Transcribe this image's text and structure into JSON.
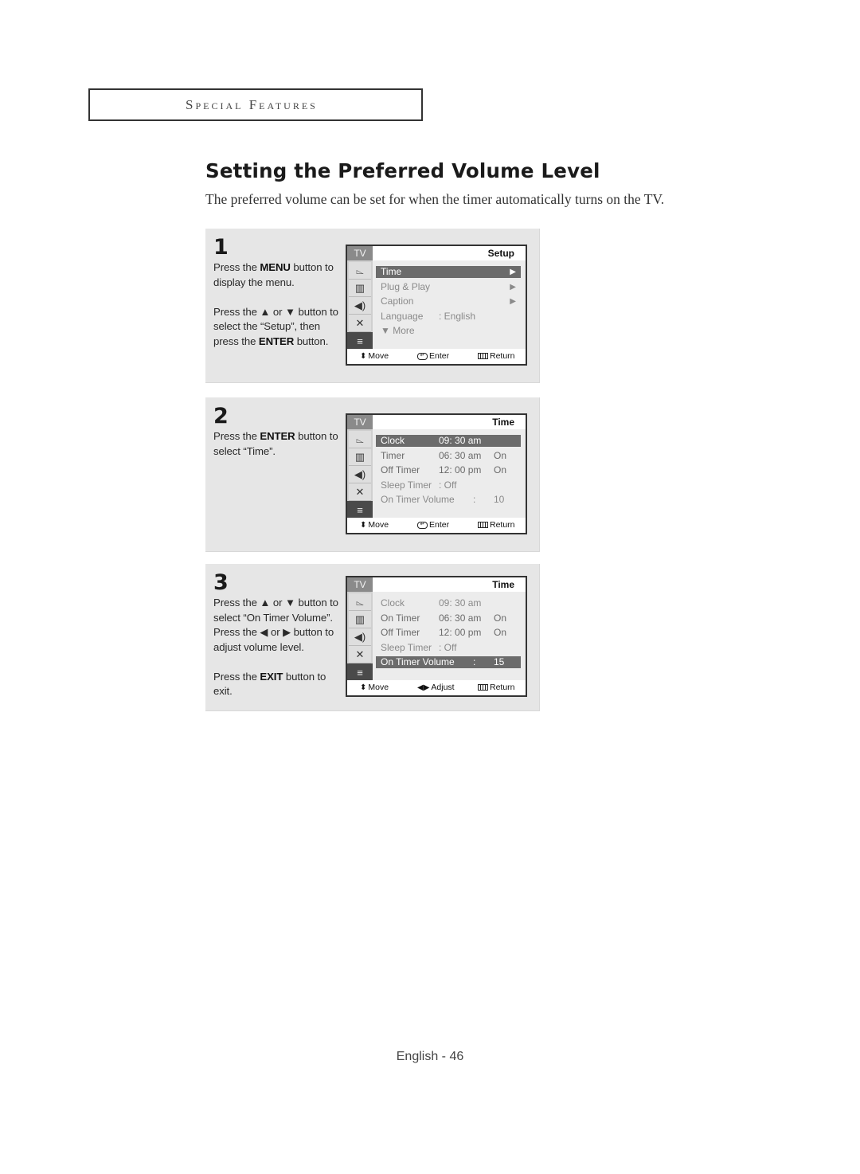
{
  "section_header": "Special Features",
  "title": "Setting the Preferred Volume Level",
  "intro": "The preferred volume can be set for when the timer automatically turns on the TV.",
  "steps": [
    {
      "number": "1",
      "paragraphs": [
        [
          {
            "t": "Press the "
          },
          {
            "t": "MENU",
            "b": true
          },
          {
            "t": " button to display the menu."
          }
        ],
        [
          {
            "t": "Press the ▲ or ▼ button to select the “Setup”, then press the "
          },
          {
            "t": "ENTER",
            "b": true
          },
          {
            "t": " button."
          }
        ]
      ],
      "osd": {
        "tv_label": "TV",
        "menu_title": "Setup",
        "rows": [
          {
            "c1": "Time",
            "arrow": "▶",
            "highlighted": true
          },
          {
            "c1": "Plug & Play",
            "arrow": "▶"
          },
          {
            "c1": "Caption",
            "arrow": "▶"
          },
          {
            "c1": "Language",
            "c2": ":  English"
          },
          {
            "c1": "  ▼ More"
          }
        ],
        "footer": [
          {
            "icon": "up-down-arrow-icon",
            "glyph": "⬍",
            "label": "Move"
          },
          {
            "icon": "enter-icon",
            "glyph": "↵",
            "label": "Enter"
          },
          {
            "icon": "return-icon",
            "glyph": "",
            "label": "Return"
          }
        ]
      }
    },
    {
      "number": "2",
      "paragraphs": [
        [
          {
            "t": "Press the "
          },
          {
            "t": "ENTER",
            "b": true
          },
          {
            "t": " button to select “Time”."
          }
        ]
      ],
      "osd": {
        "tv_label": "TV",
        "menu_title": "Time",
        "rows": [
          {
            "c1": "Clock",
            "c2": "09: 30 am",
            "highlighted": true
          },
          {
            "c1": "Timer",
            "c2": "06: 30 am",
            "c3": "On"
          },
          {
            "c1": "Off Timer",
            "c2": "12: 00 pm",
            "c3": "On"
          },
          {
            "c1": "Sleep Timer",
            "c2": "    : Off"
          },
          {
            "c1": "On Timer Volume",
            "c2": "",
            "c3": "10",
            "sep": ":"
          }
        ],
        "footer": [
          {
            "icon": "up-down-arrow-icon",
            "glyph": "⬍",
            "label": "Move"
          },
          {
            "icon": "enter-icon",
            "glyph": "↵",
            "label": "Enter"
          },
          {
            "icon": "return-icon",
            "glyph": "",
            "label": "Return"
          }
        ]
      }
    },
    {
      "number": "3",
      "paragraphs": [
        [
          {
            "t": "Press the ▲ or ▼ button to select “On Timer Volume”. Press the ◀ or ▶ button to adjust volume level."
          }
        ],
        [
          {
            "t": "Press the "
          },
          {
            "t": "EXIT",
            "b": true
          },
          {
            "t": " button to exit."
          }
        ]
      ],
      "osd": {
        "tv_label": "TV",
        "menu_title": "Time",
        "rows": [
          {
            "c1": "Clock",
            "c2": "09: 30 am"
          },
          {
            "c1": "On Timer",
            "c2": "06: 30 am",
            "c3": "On"
          },
          {
            "c1": "Off Timer",
            "c2": "12: 00 pm",
            "c3": "On"
          },
          {
            "c1": "Sleep Timer",
            "c2": "    : Off"
          },
          {
            "c1": "On Timer Volume",
            "c2": "",
            "c3": "15",
            "sep": ":",
            "highlighted": true
          }
        ],
        "footer": [
          {
            "icon": "up-down-arrow-icon",
            "glyph": "⬍",
            "label": "Move"
          },
          {
            "icon": "left-right-arrow-icon",
            "glyph": "◀▶",
            "label": "Adjust"
          },
          {
            "icon": "return-icon",
            "glyph": "",
            "label": "Return"
          }
        ]
      }
    }
  ],
  "sidebar_icons": [
    "input-icon",
    "picture-icon",
    "sound-icon",
    "channel-icon",
    "setup-icon"
  ],
  "page_footer": "English - 46"
}
